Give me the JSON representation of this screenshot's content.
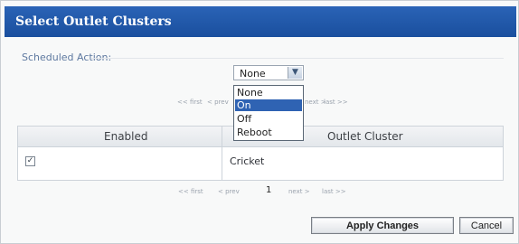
{
  "dialog": {
    "title": "Select Outlet Clusters"
  },
  "scheduled_action": {
    "label": "Scheduled Action:",
    "current_value": "None",
    "options": [
      "None",
      "On",
      "Off",
      "Reboot"
    ],
    "highlighted_option": "On"
  },
  "pager_top": {
    "first": "<< first",
    "prev": "< prev",
    "next": "next >",
    "last": "last >>"
  },
  "table": {
    "headers": [
      "Enabled",
      "Outlet Cluster"
    ],
    "rows": [
      {
        "enabled": true,
        "outlet_cluster": "Cricket"
      }
    ]
  },
  "pager_bottom": {
    "first": "<< first",
    "prev": "< prev",
    "page": "1",
    "next": "next >",
    "last": "last >>"
  },
  "buttons": {
    "apply": "Apply Changes",
    "cancel": "Cancel"
  },
  "colors": {
    "title_bar": "#1a4f9e",
    "selected_option": "#2f63b3"
  }
}
